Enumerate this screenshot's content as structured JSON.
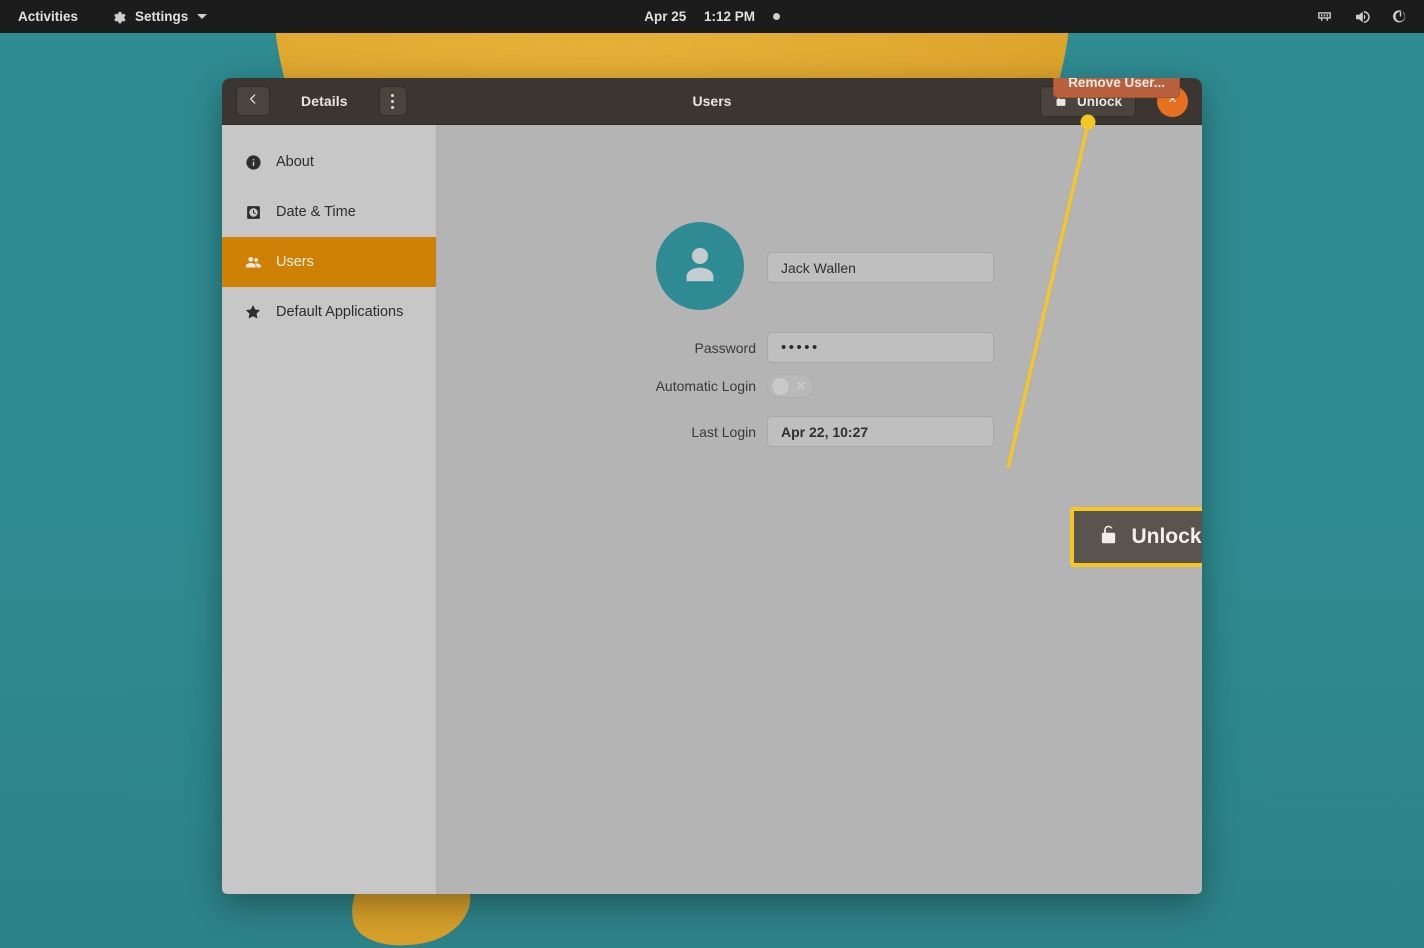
{
  "topbar": {
    "activities_label": "Activities",
    "app_menu_label": "Settings",
    "app_menu_icon": "gear-icon",
    "caret_icon": "chevron-down-icon",
    "clock_date": "Apr 25",
    "clock_time": "1:12 PM",
    "notification_dot_icon": "dot-indicator-icon",
    "status_icons": [
      "network-icon",
      "volume-icon",
      "power-icon"
    ]
  },
  "window": {
    "back_icon": "chevron-left-icon",
    "panel_label": "Details",
    "menu_icon": "overflow-menu-icon",
    "title": "Users",
    "unlock_label": "Unlock",
    "unlock_icon": "padlock-open-icon",
    "close_icon": "close-icon",
    "close_button_color": "#e5701f"
  },
  "sidebar": {
    "items": [
      {
        "label": "About",
        "icon": "info-icon",
        "active": false
      },
      {
        "label": "Date & Time",
        "icon": "clock-icon",
        "active": false
      },
      {
        "label": "Users",
        "icon": "users-icon",
        "active": true
      },
      {
        "label": "Default Applications",
        "icon": "star-icon",
        "active": false
      }
    ],
    "active_color": "#cf8106"
  },
  "user": {
    "avatar_icon": "user-avatar-icon",
    "avatar_color": "#2f8b93",
    "name_value": "Jack Wallen",
    "password_label": "Password",
    "password_value": "•••••",
    "automatic_login_label": "Automatic Login",
    "automatic_login_state": "off",
    "automatic_login_off_icon": "cross-icon",
    "last_login_label": "Last Login",
    "last_login_value": "Apr 22, 10:27"
  },
  "callout": {
    "label": "Unlock",
    "icon": "padlock-open-icon",
    "border_color": "#f6c622",
    "fill_color": "#5a544e",
    "pointer_dot_color": "#f6c622"
  },
  "actions": {
    "remove_user_label": "Remove User...",
    "remove_user_color": "#b9603f"
  },
  "desktop": {
    "background_color": "#2e8b91",
    "circle_color": "#dfa72f"
  }
}
